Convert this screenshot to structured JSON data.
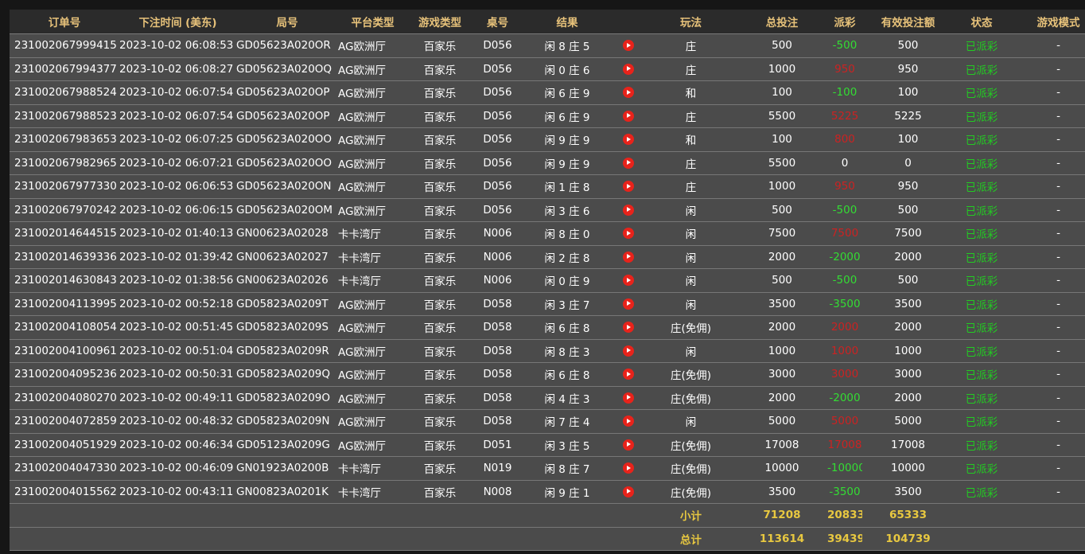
{
  "headers": [
    "订单号",
    "下注时间 (美东)",
    "局号",
    "平台类型",
    "游戏类型",
    "桌号",
    "结果",
    "",
    "玩法",
    "总投注",
    "派彩",
    "有效投注额",
    "状态",
    "游戏模式"
  ],
  "rows": [
    {
      "order": "231002067999415",
      "time": "2023-10-02 06:08:53",
      "round": "GD05623A020OR",
      "platform": "AG欧洲厅",
      "game": "百家乐",
      "table": "D056",
      "result": "闲 8 庄 5",
      "play": "庄",
      "bet": "500",
      "payout": "-500",
      "payout_color": "pos",
      "valid": "500",
      "status": "已派彩",
      "mode": "-"
    },
    {
      "order": "231002067994377",
      "time": "2023-10-02 06:08:27",
      "round": "GD05623A020OQ",
      "platform": "AG欧洲厅",
      "game": "百家乐",
      "table": "D056",
      "result": "闲 0 庄 6",
      "play": "庄",
      "bet": "1000",
      "payout": "950",
      "payout_color": "neg",
      "valid": "950",
      "status": "已派彩",
      "mode": "-"
    },
    {
      "order": "231002067988524",
      "time": "2023-10-02 06:07:54",
      "round": "GD05623A020OP",
      "platform": "AG欧洲厅",
      "game": "百家乐",
      "table": "D056",
      "result": "闲 6 庄 9",
      "play": "和",
      "bet": "100",
      "payout": "-100",
      "payout_color": "pos",
      "valid": "100",
      "status": "已派彩",
      "mode": "-"
    },
    {
      "order": "231002067988523",
      "time": "2023-10-02 06:07:54",
      "round": "GD05623A020OP",
      "platform": "AG欧洲厅",
      "game": "百家乐",
      "table": "D056",
      "result": "闲 6 庄 9",
      "play": "庄",
      "bet": "5500",
      "payout": "5225",
      "payout_color": "neg",
      "valid": "5225",
      "status": "已派彩",
      "mode": "-"
    },
    {
      "order": "231002067983653",
      "time": "2023-10-02 06:07:25",
      "round": "GD05623A020OO",
      "platform": "AG欧洲厅",
      "game": "百家乐",
      "table": "D056",
      "result": "闲 9 庄 9",
      "play": "和",
      "bet": "100",
      "payout": "800",
      "payout_color": "neg",
      "valid": "100",
      "status": "已派彩",
      "mode": "-"
    },
    {
      "order": "231002067982965",
      "time": "2023-10-02 06:07:21",
      "round": "GD05623A020OO",
      "platform": "AG欧洲厅",
      "game": "百家乐",
      "table": "D056",
      "result": "闲 9 庄 9",
      "play": "庄",
      "bet": "5500",
      "payout": "0",
      "payout_color": "zero",
      "valid": "0",
      "status": "已派彩",
      "mode": "-"
    },
    {
      "order": "231002067977330",
      "time": "2023-10-02 06:06:53",
      "round": "GD05623A020ON",
      "platform": "AG欧洲厅",
      "game": "百家乐",
      "table": "D056",
      "result": "闲 1 庄 8",
      "play": "庄",
      "bet": "1000",
      "payout": "950",
      "payout_color": "neg",
      "valid": "950",
      "status": "已派彩",
      "mode": "-"
    },
    {
      "order": "231002067970242",
      "time": "2023-10-02 06:06:15",
      "round": "GD05623A020OM",
      "platform": "AG欧洲厅",
      "game": "百家乐",
      "table": "D056",
      "result": "闲 3 庄 6",
      "play": "闲",
      "bet": "500",
      "payout": "-500",
      "payout_color": "pos",
      "valid": "500",
      "status": "已派彩",
      "mode": "-"
    },
    {
      "order": "231002014644515",
      "time": "2023-10-02 01:40:13",
      "round": "GN00623A02028",
      "platform": "卡卡湾厅",
      "game": "百家乐",
      "table": "N006",
      "result": "闲 8 庄 0",
      "play": "闲",
      "bet": "7500",
      "payout": "7500",
      "payout_color": "neg",
      "valid": "7500",
      "status": "已派彩",
      "mode": "-"
    },
    {
      "order": "231002014639336",
      "time": "2023-10-02 01:39:42",
      "round": "GN00623A02027",
      "platform": "卡卡湾厅",
      "game": "百家乐",
      "table": "N006",
      "result": "闲 2 庄 8",
      "play": "闲",
      "bet": "2000",
      "payout": "-2000",
      "payout_color": "pos",
      "valid": "2000",
      "status": "已派彩",
      "mode": "-"
    },
    {
      "order": "231002014630843",
      "time": "2023-10-02 01:38:56",
      "round": "GN00623A02026",
      "platform": "卡卡湾厅",
      "game": "百家乐",
      "table": "N006",
      "result": "闲 0 庄 9",
      "play": "闲",
      "bet": "500",
      "payout": "-500",
      "payout_color": "pos",
      "valid": "500",
      "status": "已派彩",
      "mode": "-"
    },
    {
      "order": "231002004113995",
      "time": "2023-10-02 00:52:18",
      "round": "GD05823A0209T",
      "platform": "AG欧洲厅",
      "game": "百家乐",
      "table": "D058",
      "result": "闲 3 庄 7",
      "play": "闲",
      "bet": "3500",
      "payout": "-3500",
      "payout_color": "pos",
      "valid": "3500",
      "status": "已派彩",
      "mode": "-"
    },
    {
      "order": "231002004108054",
      "time": "2023-10-02 00:51:45",
      "round": "GD05823A0209S",
      "platform": "AG欧洲厅",
      "game": "百家乐",
      "table": "D058",
      "result": "闲 6 庄 8",
      "play": "庄(免佣)",
      "bet": "2000",
      "payout": "2000",
      "payout_color": "neg",
      "valid": "2000",
      "status": "已派彩",
      "mode": "-"
    },
    {
      "order": "231002004100961",
      "time": "2023-10-02 00:51:04",
      "round": "GD05823A0209R",
      "platform": "AG欧洲厅",
      "game": "百家乐",
      "table": "D058",
      "result": "闲 8 庄 3",
      "play": "闲",
      "bet": "1000",
      "payout": "1000",
      "payout_color": "neg",
      "valid": "1000",
      "status": "已派彩",
      "mode": "-"
    },
    {
      "order": "231002004095236",
      "time": "2023-10-02 00:50:31",
      "round": "GD05823A0209Q",
      "platform": "AG欧洲厅",
      "game": "百家乐",
      "table": "D058",
      "result": "闲 6 庄 8",
      "play": "庄(免佣)",
      "bet": "3000",
      "payout": "3000",
      "payout_color": "neg",
      "valid": "3000",
      "status": "已派彩",
      "mode": "-"
    },
    {
      "order": "231002004080270",
      "time": "2023-10-02 00:49:11",
      "round": "GD05823A0209O",
      "platform": "AG欧洲厅",
      "game": "百家乐",
      "table": "D058",
      "result": "闲 4 庄 3",
      "play": "庄(免佣)",
      "bet": "2000",
      "payout": "-2000",
      "payout_color": "pos",
      "valid": "2000",
      "status": "已派彩",
      "mode": "-"
    },
    {
      "order": "231002004072859",
      "time": "2023-10-02 00:48:32",
      "round": "GD05823A0209N",
      "platform": "AG欧洲厅",
      "game": "百家乐",
      "table": "D058",
      "result": "闲 7 庄 4",
      "play": "闲",
      "bet": "5000",
      "payout": "5000",
      "payout_color": "neg",
      "valid": "5000",
      "status": "已派彩",
      "mode": "-"
    },
    {
      "order": "231002004051929",
      "time": "2023-10-02 00:46:34",
      "round": "GD05123A0209G",
      "platform": "AG欧洲厅",
      "game": "百家乐",
      "table": "D051",
      "result": "闲 3 庄 5",
      "play": "庄(免佣)",
      "bet": "17008",
      "payout": "17008",
      "payout_color": "neg",
      "valid": "17008",
      "status": "已派彩",
      "mode": "-"
    },
    {
      "order": "231002004047330",
      "time": "2023-10-02 00:46:09",
      "round": "GN01923A0200B",
      "platform": "卡卡湾厅",
      "game": "百家乐",
      "table": "N019",
      "result": "闲 8 庄 7",
      "play": "庄(免佣)",
      "bet": "10000",
      "payout": "-10000",
      "payout_color": "pos",
      "valid": "10000",
      "status": "已派彩",
      "mode": "-"
    },
    {
      "order": "231002004015562",
      "time": "2023-10-02 00:43:11",
      "round": "GN00823A0201K",
      "platform": "卡卡湾厅",
      "game": "百家乐",
      "table": "N008",
      "result": "闲 9 庄 1",
      "play": "庄(免佣)",
      "bet": "3500",
      "payout": "-3500",
      "payout_color": "pos",
      "valid": "3500",
      "status": "已派彩",
      "mode": "-"
    }
  ],
  "subtotal": {
    "label": "小计",
    "bet": "71208",
    "payout": "20833",
    "valid": "65333"
  },
  "total": {
    "label": "总计",
    "bet": "113614",
    "payout": "39439",
    "valid": "104739"
  },
  "icons": {
    "play": "play-circle-icon"
  },
  "colors": {
    "header_text": "#e7c27a",
    "row_bg": "#4b4b4b",
    "positive": "#33dd33",
    "negative": "#cc2222",
    "status": "#22cc22",
    "total_text": "#e8c840"
  }
}
